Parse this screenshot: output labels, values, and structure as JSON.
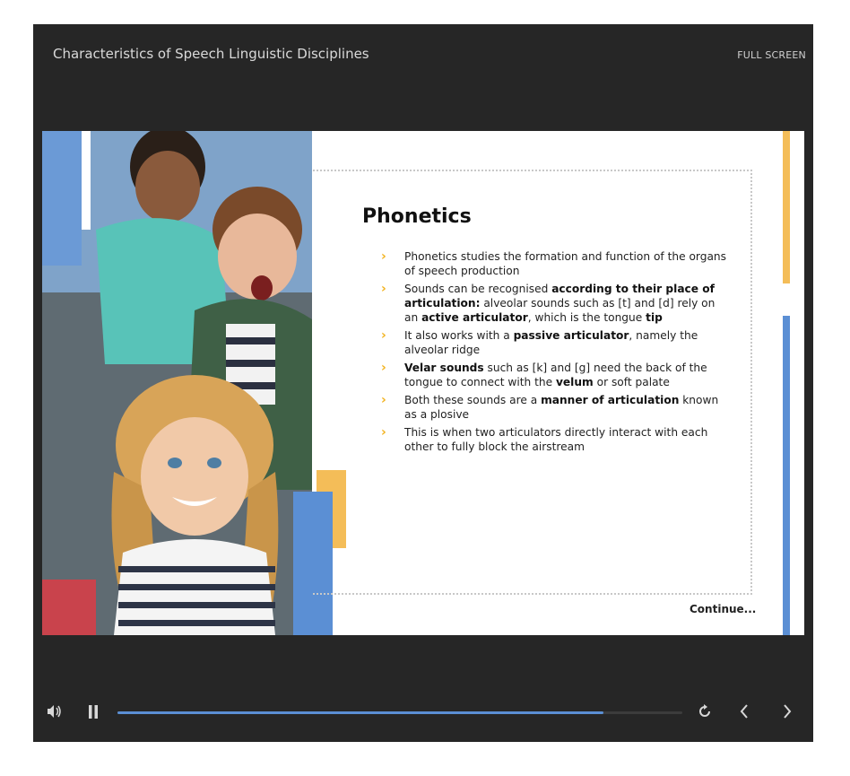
{
  "player": {
    "title": "Characteristics of Speech Linguistic Disciplines",
    "fullscreen_label": "FULL SCREEN",
    "progress": 0.86
  },
  "slide": {
    "heading": "Phonetics",
    "continue_label": "Continue...",
    "bullets": [
      {
        "parts": [
          {
            "t": "Phonetics studies the formation and function of the organs of speech production",
            "b": false
          }
        ]
      },
      {
        "parts": [
          {
            "t": "Sounds can be recognised ",
            "b": false
          },
          {
            "t": "according to their place of articulation:",
            "b": true
          },
          {
            "t": " alveolar sounds such as [t] and [d] rely on an ",
            "b": false
          },
          {
            "t": "active articulator",
            "b": true
          },
          {
            "t": ", which is the tongue ",
            "b": false
          },
          {
            "t": "tip",
            "b": true
          }
        ]
      },
      {
        "parts": [
          {
            "t": " It also works with a ",
            "b": false
          },
          {
            "t": "passive articulator",
            "b": true
          },
          {
            "t": ", namely the alveolar ridge",
            "b": false
          }
        ]
      },
      {
        "parts": [
          {
            "t": "Velar sounds",
            "b": true
          },
          {
            "t": " such as [k] and [g] need the back of the tongue to connect with the ",
            "b": false
          },
          {
            "t": "velum",
            "b": true
          },
          {
            "t": " or soft palate",
            "b": false
          }
        ]
      },
      {
        "parts": [
          {
            "t": "Both these sounds are a ",
            "b": false
          },
          {
            "t": "manner of articulation",
            "b": true
          },
          {
            "t": " known as a plosive",
            "b": false
          }
        ]
      },
      {
        "parts": [
          {
            "t": "This is when two articulators directly interact with each other to fully block the airstream",
            "b": false
          }
        ]
      }
    ]
  },
  "colors": {
    "accent_blue": "#5b8fd4",
    "accent_yellow": "#f4bd58",
    "bullet_chevron": "#f2b320",
    "player_bg": "#262626"
  },
  "icons": {
    "volume": "volume-icon",
    "pause": "pause-icon",
    "replay": "replay-icon",
    "prev": "chevron-left-icon",
    "next": "chevron-right-icon",
    "bullet": "chevron-right-bullet-icon"
  }
}
